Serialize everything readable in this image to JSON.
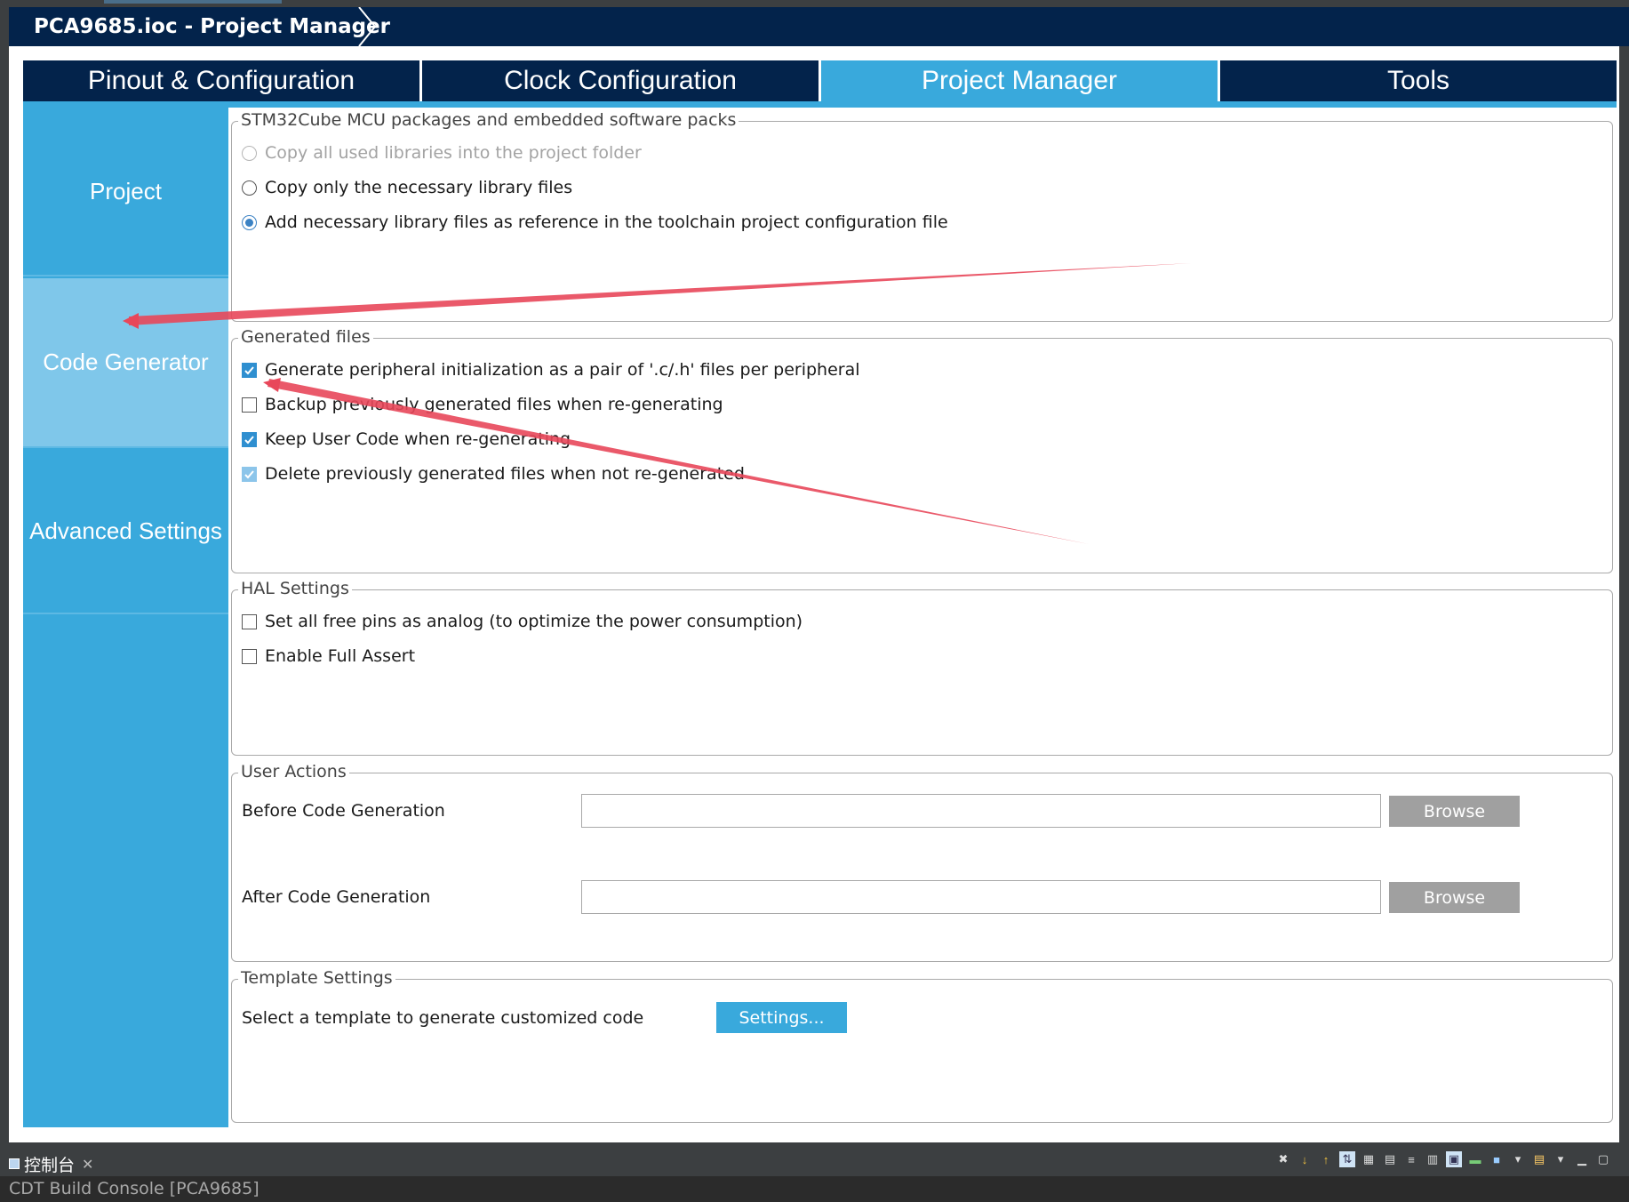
{
  "window": {
    "title": "PCA9685.ioc - Project Manager"
  },
  "main_tabs": [
    {
      "label": "Pinout & Configuration",
      "active": false
    },
    {
      "label": "Clock Configuration",
      "active": false
    },
    {
      "label": "Project Manager",
      "active": true
    },
    {
      "label": "Tools",
      "active": false
    }
  ],
  "sidenav": [
    {
      "label": "Project",
      "active": false
    },
    {
      "label": "Code Generator",
      "active": true
    },
    {
      "label": "Advanced Settings",
      "active": false
    }
  ],
  "packs": {
    "legend": "STM32Cube MCU packages and embedded software packs",
    "options": [
      {
        "label": "Copy all used libraries into the project folder",
        "selected": false,
        "disabled": true
      },
      {
        "label": "Copy only the necessary library files",
        "selected": false,
        "disabled": false
      },
      {
        "label": "Add necessary library files as reference in the toolchain project configuration file",
        "selected": true,
        "disabled": false
      }
    ]
  },
  "generated_files": {
    "legend": "Generated files",
    "options": [
      {
        "label": "Generate peripheral initialization as a pair of '.c/.h' files per peripheral",
        "checked": true
      },
      {
        "label": "Backup previously generated files when re-generating",
        "checked": false
      },
      {
        "label": "Keep User Code when re-generating",
        "checked": true
      },
      {
        "label": "Delete previously generated files when not re-generated",
        "checked": true
      }
    ]
  },
  "hal": {
    "legend": "HAL Settings",
    "options": [
      {
        "label": "Set all free pins as analog (to optimize the power consumption)",
        "checked": false
      },
      {
        "label": "Enable Full Assert",
        "checked": false
      }
    ]
  },
  "user_actions": {
    "legend": "User Actions",
    "before_label": "Before Code Generation",
    "before_value": "",
    "after_label": "After Code Generation",
    "after_value": "",
    "browse_label": "Browse"
  },
  "template": {
    "legend": "Template Settings",
    "label": "Select a template to generate customized code",
    "button": "Settings..."
  },
  "console": {
    "tab_label": "控制台",
    "text": "CDT Build Console [PCA9685]"
  },
  "colors": {
    "accent": "#39a9dc",
    "navy": "#03234b",
    "annotation": "#e8475a"
  }
}
